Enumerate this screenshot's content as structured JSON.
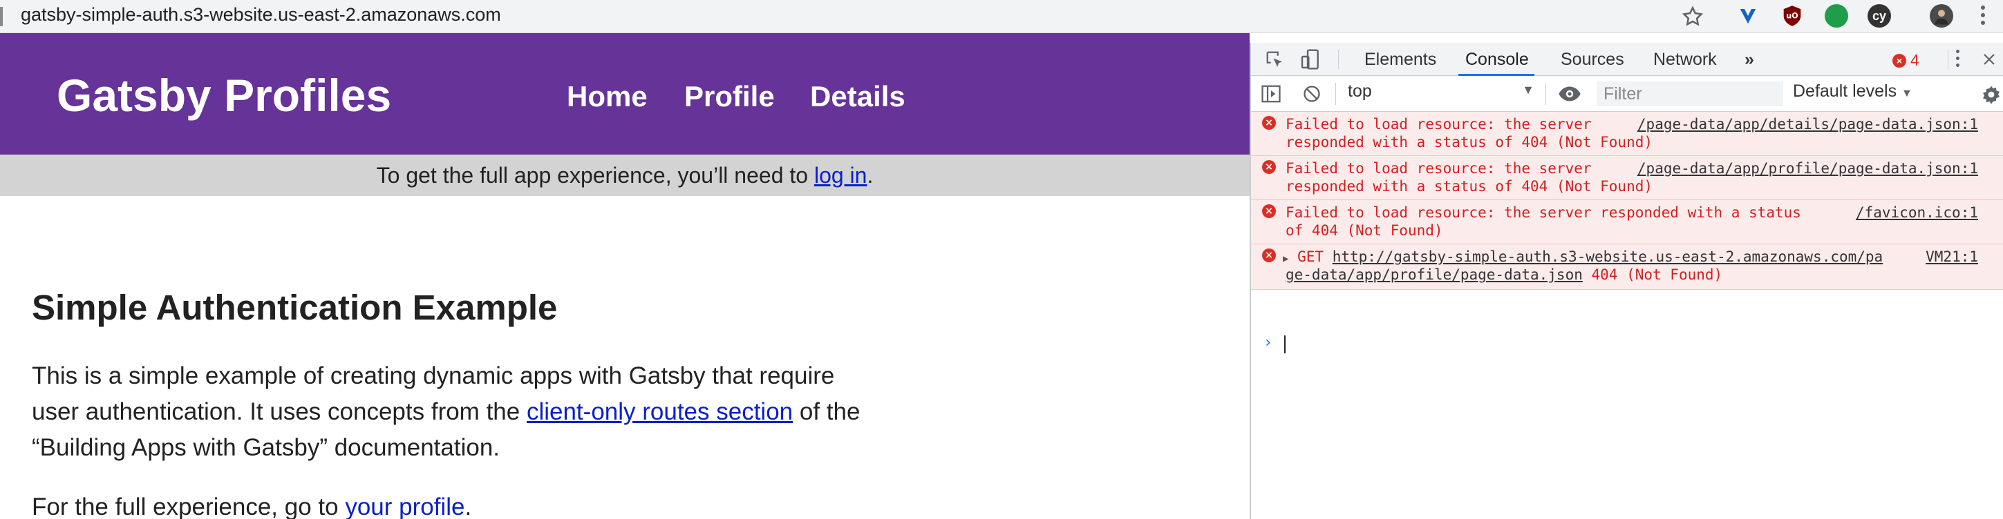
{
  "browser": {
    "url": "gatsby-simple-auth.s3-website.us-east-2.amazonaws.com"
  },
  "site": {
    "title": "Gatsby Profiles",
    "nav": [
      "Home",
      "Profile",
      "Details"
    ],
    "notice_prefix": "To get the full app experience, you’ll need to ",
    "notice_link": "log in",
    "notice_suffix": ".",
    "heading": "Simple Authentication Example",
    "para1_line1": "This is a simple example of creating dynamic apps with Gatsby that require",
    "para1_line2_prefix": "user authentication. It uses concepts from the ",
    "para1_link": "client-only routes section",
    "para1_line2_suffix": " of the",
    "para1_line3": "“Building Apps with Gatsby” documentation.",
    "para2_prefix": "For the full experience, go to ",
    "para2_link": "your profile",
    "para2_suffix": ".",
    "header_color": "#663399"
  },
  "devtools": {
    "tabs": [
      "Elements",
      "Console",
      "Sources",
      "Network"
    ],
    "active_tab": "Console",
    "error_count": "4",
    "context": "top",
    "filter_placeholder": "Filter",
    "levels": "Default levels",
    "messages": [
      {
        "line1": "Failed to load resource: the server",
        "line2": "responded with a status of 404 (Not Found)",
        "source": "/page-data/app/details/page-data.json:1"
      },
      {
        "line1": "Failed to load resource: the server",
        "line2": "responded with a status of 404 (Not Found)",
        "source": "/page-data/app/profile/page-data.json:1"
      },
      {
        "line1": "Failed to load resource: the server responded with a status",
        "line2": "of 404 (Not Found)",
        "source": "/favicon.ico:1"
      },
      {
        "method": "GET",
        "url_line1": "http://gatsby-simple-auth.s3-website.us-east-2.amazonaws.com/pa",
        "url_line2": "ge-data/app/profile/page-data.json",
        "status": " 404 (Not Found)",
        "source": "VM21:1"
      }
    ],
    "prompt": "›"
  },
  "extensions": [
    "ublock",
    "cy"
  ]
}
